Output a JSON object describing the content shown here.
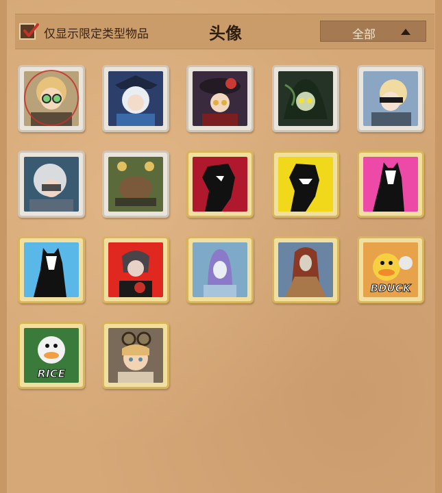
{
  "header": {
    "filter_checked": true,
    "filter_label": "仅显示限定类型物品",
    "title": "头像",
    "dropdown_value": "全部"
  },
  "colors": {
    "background": "#d6a878",
    "header_bar": "#c99c6a",
    "dropdown": "#a57a52",
    "check_red": "#c8302a"
  },
  "avatars": [
    {
      "name": "avatar-blonde-goggles",
      "frame": "silver",
      "selected": true
    },
    {
      "name": "avatar-white-hair-tricorn",
      "frame": "silver"
    },
    {
      "name": "avatar-red-flower-hat",
      "frame": "silver"
    },
    {
      "name": "avatar-green-vines-hair",
      "frame": "silver"
    },
    {
      "name": "avatar-blindfold-glasses",
      "frame": "silver"
    },
    {
      "name": "avatar-white-curls-robot",
      "frame": "silver"
    },
    {
      "name": "avatar-tank-machine",
      "frame": "silver"
    },
    {
      "name": "avatar-joker-crimson",
      "frame": "gold"
    },
    {
      "name": "avatar-joker-yellow",
      "frame": "gold"
    },
    {
      "name": "avatar-fox-mask-pink",
      "frame": "gold"
    },
    {
      "name": "avatar-fox-mask-blue",
      "frame": "gold"
    },
    {
      "name": "avatar-dark-hair-red",
      "frame": "gold"
    },
    {
      "name": "avatar-purple-mask",
      "frame": "gold"
    },
    {
      "name": "avatar-red-hair-mask",
      "frame": "gold"
    },
    {
      "name": "avatar-duck-bduck",
      "frame": "gold",
      "caption": "BDUCK"
    },
    {
      "name": "avatar-duck-rice",
      "frame": "gold",
      "caption": "RICE"
    },
    {
      "name": "avatar-goggles-girl",
      "frame": "gold"
    }
  ]
}
